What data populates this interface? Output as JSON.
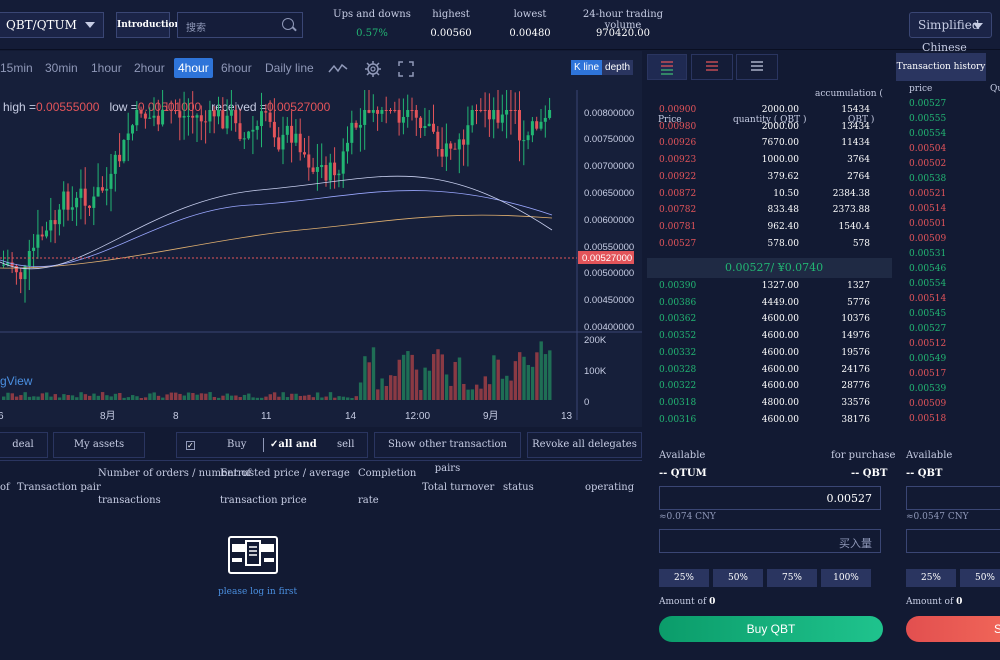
{
  "header": {
    "pair": "QBT/QTUM",
    "intro": "Introduction",
    "search_placeholder": "搜索",
    "stats": [
      {
        "label": "Ups and downs",
        "value": "0.57%"
      },
      {
        "label": "highest",
        "value": "0.00560"
      },
      {
        "label": "lowest",
        "value": "0.00480"
      },
      {
        "label": "24-hour trading volume",
        "value": "970420.00"
      }
    ],
    "lang": "Simplified",
    "lang_sub": "Chinese"
  },
  "chart": {
    "timeframes": [
      "15min",
      "30min",
      "1hour",
      "2hour",
      "4hour",
      "6hour",
      "Daily line"
    ],
    "active_timeframe": "4hour",
    "kline": "K line",
    "depth": "depth",
    "ohlc": {
      "high_label": "high =",
      "high": "0.00555000",
      "low_label": "low =",
      "low": "0.00501000",
      "recv_label": "received =",
      "recv": "0.00527000"
    },
    "price_ticks": [
      "0.00800000",
      "0.00750000",
      "0.00700000",
      "0.00650000",
      "0.00600000",
      "0.00550000",
      "0.00527000",
      "0.00500000",
      "0.00450000",
      "0.00400000"
    ],
    "vol_ticks": [
      "200K",
      "100K",
      "0"
    ],
    "x_ticks": [
      "6",
      "8月",
      "8",
      "11",
      "14",
      "12:00",
      "9月",
      "13"
    ],
    "watermark": "gView"
  },
  "orders": {
    "tabs": [
      "deal",
      "My assets"
    ],
    "filter": {
      "buy": "Buy",
      "all": "all and",
      "sell": "sell"
    },
    "other_pairs": "Show other transaction pairs",
    "revoke": "Revoke all delegates",
    "columns": {
      "c0": "of",
      "c1": "Transaction pair",
      "c2": "Number of orders / number of",
      "c2b": "transactions",
      "c3": "Entrusted price / average",
      "c3b": "transaction price",
      "c4": "Completion",
      "c4b": "rate",
      "c5": "Total turnover",
      "c6": "status",
      "c7": "operating"
    },
    "login": "please log in first"
  },
  "orderbook": {
    "accum_label": "accumulation (",
    "header": {
      "price": "Price",
      "qty": "quantity ( QBT )",
      "unit": "QBT )"
    },
    "asks": [
      {
        "p": "0.00900",
        "q": "2000.00",
        "a": "15434"
      },
      {
        "p": "0.00980",
        "q": "2000.00",
        "a": "13434"
      },
      {
        "p": "0.00926",
        "q": "7670.00",
        "a": "11434"
      },
      {
        "p": "0.00923",
        "q": "1000.00",
        "a": "3764"
      },
      {
        "p": "0.00922",
        "q": "379.62",
        "a": "2764"
      },
      {
        "p": "0.00872",
        "q": "10.50",
        "a": "2384.38"
      },
      {
        "p": "0.00782",
        "q": "833.48",
        "a": "2373.88"
      },
      {
        "p": "0.00781",
        "q": "962.40",
        "a": "1540.4"
      },
      {
        "p": "0.00527",
        "q": "578.00",
        "a": "578"
      }
    ],
    "last": "0.00527/ ¥0.0740",
    "bids": [
      {
        "p": "0.00390",
        "q": "1327.00",
        "a": "1327"
      },
      {
        "p": "0.00386",
        "q": "4449.00",
        "a": "5776"
      },
      {
        "p": "0.00362",
        "q": "4600.00",
        "a": "10376"
      },
      {
        "p": "0.00352",
        "q": "4600.00",
        "a": "14976"
      },
      {
        "p": "0.00332",
        "q": "4600.00",
        "a": "19576"
      },
      {
        "p": "0.00328",
        "q": "4600.00",
        "a": "24176"
      },
      {
        "p": "0.00322",
        "q": "4600.00",
        "a": "28776"
      },
      {
        "p": "0.00318",
        "q": "4800.00",
        "a": "33576"
      },
      {
        "p": "0.00316",
        "q": "4600.00",
        "a": "38176"
      }
    ]
  },
  "history": {
    "tab": "Transaction history",
    "price_label": "price",
    "qty_label": "Qu",
    "rows": [
      {
        "p": "0.00527",
        "s": "bid"
      },
      {
        "p": "0.00555",
        "s": "bid"
      },
      {
        "p": "0.00554",
        "s": "bid"
      },
      {
        "p": "0.00504",
        "s": "ask"
      },
      {
        "p": "0.00502",
        "s": "ask"
      },
      {
        "p": "0.00538",
        "s": "bid"
      },
      {
        "p": "0.00521",
        "s": "ask"
      },
      {
        "p": "0.00514",
        "s": "ask"
      },
      {
        "p": "0.00501",
        "s": "ask"
      },
      {
        "p": "0.00509",
        "s": "ask"
      },
      {
        "p": "0.00531",
        "s": "bid"
      },
      {
        "p": "0.00546",
        "s": "bid"
      },
      {
        "p": "0.00554",
        "s": "bid"
      },
      {
        "p": "0.00514",
        "s": "ask"
      },
      {
        "p": "0.00545",
        "s": "bid"
      },
      {
        "p": "0.00527",
        "s": "bid"
      },
      {
        "p": "0.00512",
        "s": "ask"
      },
      {
        "p": "0.00549",
        "s": "bid"
      },
      {
        "p": "0.00517",
        "s": "ask"
      },
      {
        "p": "0.00539",
        "s": "bid"
      },
      {
        "p": "0.00509",
        "s": "ask"
      },
      {
        "p": "0.00518",
        "s": "ask"
      }
    ]
  },
  "buy": {
    "available": "Available",
    "for_purchase": "for purchase",
    "bal_left": "-- QTUM",
    "bal_right": "-- QBT",
    "price": "0.00527",
    "cny": "≈0.074 CNY",
    "amount_placeholder": "买入量",
    "pcts": [
      "25%",
      "50%",
      "75%",
      "100%"
    ],
    "amount_label": "Amount of",
    "amount": "0",
    "button": "Buy QBT"
  },
  "sell": {
    "available": "Available",
    "bal": "-- QBT",
    "cny": "≈0.0547 CNY",
    "pcts": [
      "25%",
      "50%"
    ],
    "amount_label": "Amount of",
    "amount": "0",
    "button": "S"
  },
  "colors": {
    "up": "#22b573",
    "down": "#e2545a",
    "accent": "#2e74d9"
  }
}
